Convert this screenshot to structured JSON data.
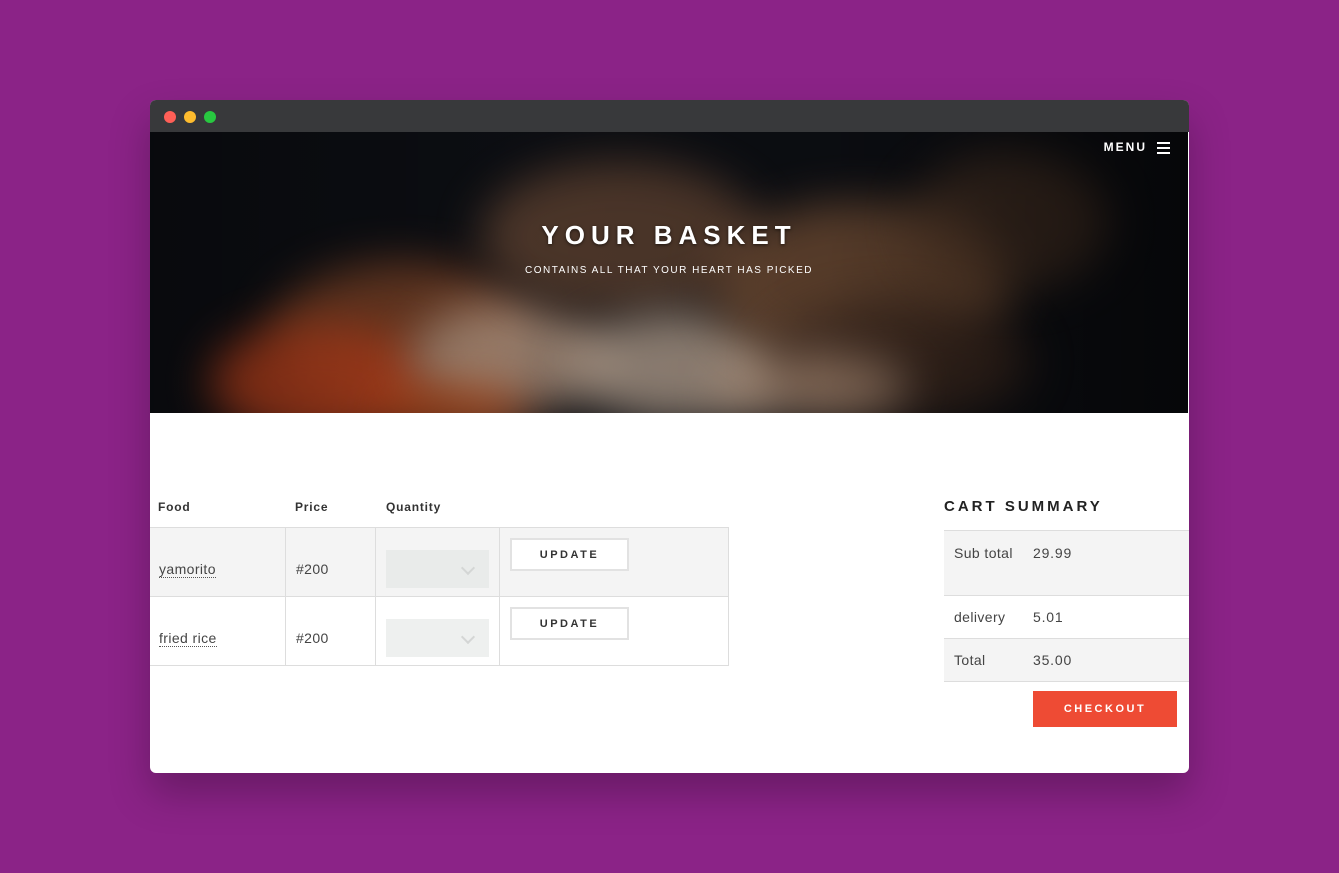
{
  "header": {
    "menu_label": "MENU",
    "title": "YOUR BASKET",
    "subtitle": "CONTAINS ALL THAT YOUR HEART HAS PICKED"
  },
  "cart": {
    "columns": [
      "Food",
      "Price",
      "Quantity"
    ],
    "items": [
      {
        "food": "yamorito",
        "price": "#200",
        "update_label": "UPDATE"
      },
      {
        "food": "fried rice",
        "price": "#200",
        "update_label": "UPDATE"
      }
    ]
  },
  "summary": {
    "title": "CART SUMMARY",
    "rows": [
      {
        "label": "Sub total",
        "value": "29.99"
      },
      {
        "label": "delivery",
        "value": "5.01"
      },
      {
        "label": "Total",
        "value": "35.00"
      }
    ],
    "checkout_label": "CHECKOUT"
  },
  "colors": {
    "page_background": "#8b2387",
    "checkout": "#ee4b34",
    "titlebar": "#38393b"
  }
}
